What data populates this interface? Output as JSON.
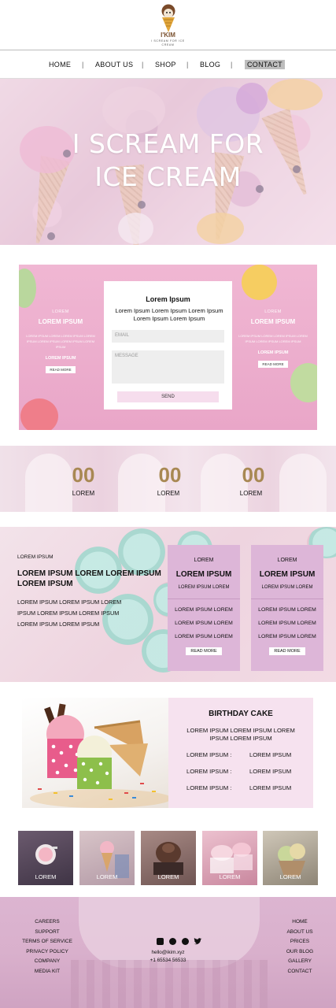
{
  "brand": {
    "name": "I'KIM",
    "tagline": "I SCREAM FOR ICE CREAM"
  },
  "nav": {
    "items": [
      "HOME",
      "ABOUT US",
      "SHOP",
      "BLOG",
      "CONTACT"
    ],
    "active": "CONTACT"
  },
  "hero": {
    "line1": "I SCREAM FOR",
    "line2": "ICE CREAM"
  },
  "promo": {
    "left": {
      "small": "LOREM",
      "heading": "LOREM IPSUM",
      "body": "LOREM IPSUM LOREM LOREM IPSUM LOREM IPSUM LOREM IPSUM LOREM IPSUM LOREM IPSUM",
      "sub": "LOREM IPSUM",
      "button": "READ MORE"
    },
    "right": {
      "small": "LOREM",
      "heading": "LOREM IPSUM",
      "body": "LOREM IPSUM LOREM LOREM IPSUM LOREM IPSUM LOREM IPSUM LOREM IPSUM",
      "sub": "LOREM IPSUM",
      "button": "READ MORE"
    },
    "form": {
      "title": "Lorem Ipsum",
      "desc": "Lorem Ipsum Lorem Ipsum Lorem Ipsum Lorem Ipsum Lorem Ipsum",
      "email_placeholder": "EMAIL",
      "message_placeholder": "MESSAGE",
      "send": "SEND"
    }
  },
  "counters": [
    {
      "value": "00",
      "label": "LOREM"
    },
    {
      "value": "00",
      "label": "LOREM"
    },
    {
      "value": "00",
      "label": "LOREM"
    }
  ],
  "cupcakes": {
    "small": "LOREM IPSUM",
    "heading": "LOREM IPSUM LOREM LOREM IPSUM LOREM IPSUM",
    "body": "LOREM IPSUM LOREM IPSUM LOREM IPSUM LOREM IPSUM LOREM IPSUM LOREM IPSUM LOREM IPSUM",
    "cards": [
      {
        "top": "LOREM",
        "title": "LOREM IPSUM",
        "sub": "LOREM IPSUM LOREM",
        "items": [
          "LOREM IPSUM LOREM",
          "LOREM IPSUM LOREM",
          "LOREM IPSUM LOREM"
        ],
        "button": "READ MORE"
      },
      {
        "top": "LOREM",
        "title": "LOREM IPSUM",
        "sub": "LOREM IPSUM LOREM",
        "items": [
          "LOREM IPSUM LOREM",
          "LOREM IPSUM LOREM",
          "LOREM IPSUM LOREM"
        ],
        "button": "READ MORE"
      }
    ]
  },
  "birthday": {
    "title": "BIRTHDAY CAKE",
    "desc": "LOREM IPSUM LOREM IPSUM LOREM IPSUM LOREM IPSUM",
    "rows": [
      {
        "k": "LOREM IPSUM :",
        "v": "LOREM IPSUM"
      },
      {
        "k": "LOREM IPSUM :",
        "v": "LOREM IPSUM"
      },
      {
        "k": "LOREM IPSUM :",
        "v": "LOREM IPSUM"
      }
    ]
  },
  "gallery": [
    "LOREM",
    "LOREM",
    "LOREM",
    "LOREM",
    "LOREM"
  ],
  "footer": {
    "left": [
      "CAREERS",
      "SUPPORT",
      "TERMS OF SERVICE",
      "PRIVACY POLICY",
      "COMPANY",
      "MEDIA KIT"
    ],
    "right": [
      "HOME",
      "ABOUT US",
      "PRICES",
      "OUR BLOG",
      "GALLERY",
      "CONTACT"
    ],
    "social": [
      "instagram-icon",
      "whatsapp-icon",
      "facebook-icon",
      "twitter-icon"
    ],
    "email": "hello@ikim.xyz",
    "phone": "+1 65534 56533"
  },
  "colors": {
    "counter_number": "#a88853",
    "promo_pink": "#f0b7d3",
    "card_purple": "#ddb6d8",
    "birthday_bg": "#f6e2ef",
    "footer_pink": "#dcb5d1",
    "nav_active": "#bdbdbd"
  }
}
